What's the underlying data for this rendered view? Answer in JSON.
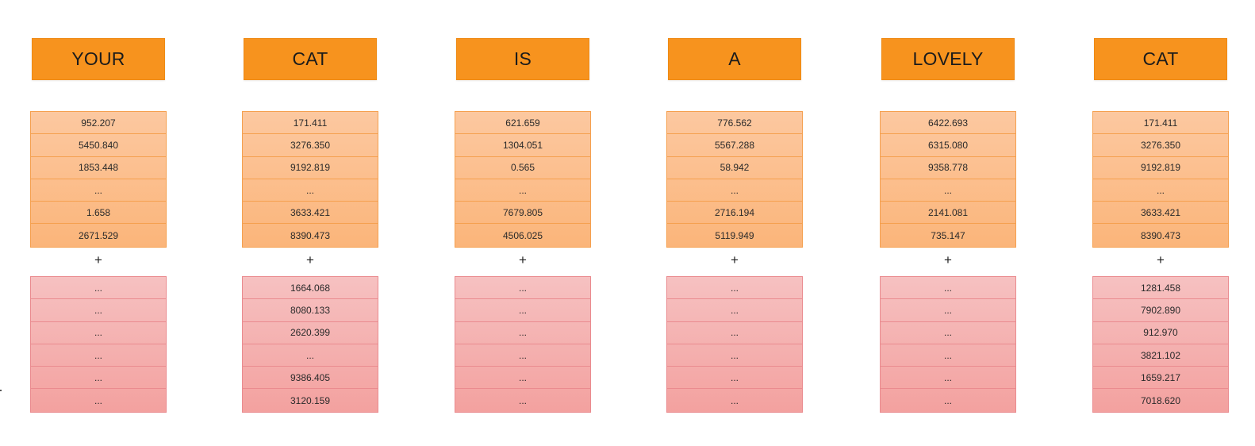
{
  "columns": [
    {
      "word": "YOUR",
      "embedding": [
        "952.207",
        "5450.840",
        "1853.448",
        "...",
        "1.658",
        "2671.529"
      ],
      "plus": "+",
      "position": [
        "...",
        "...",
        "...",
        "...",
        "...",
        "..."
      ]
    },
    {
      "word": "CAT",
      "embedding": [
        "171.411",
        "3276.350",
        "9192.819",
        "...",
        "3633.421",
        "8390.473"
      ],
      "plus": "+",
      "position": [
        "1664.068",
        "8080.133",
        "2620.399",
        "...",
        "9386.405",
        "3120.159"
      ]
    },
    {
      "word": "IS",
      "embedding": [
        "621.659",
        "1304.051",
        "0.565",
        "...",
        "7679.805",
        "4506.025"
      ],
      "plus": "+",
      "position": [
        "...",
        "...",
        "...",
        "...",
        "...",
        "..."
      ]
    },
    {
      "word": "A",
      "embedding": [
        "776.562",
        "5567.288",
        "58.942",
        "...",
        "2716.194",
        "5119.949"
      ],
      "plus": "+",
      "position": [
        "...",
        "...",
        "...",
        "...",
        "...",
        "..."
      ]
    },
    {
      "word": "LOVELY",
      "embedding": [
        "6422.693",
        "6315.080",
        "9358.778",
        "...",
        "2141.081",
        "735.147"
      ],
      "plus": "+",
      "position": [
        "...",
        "...",
        "...",
        "...",
        "...",
        "..."
      ]
    },
    {
      "word": "CAT",
      "embedding": [
        "171.411",
        "3276.350",
        "9192.819",
        "...",
        "3633.421",
        "8390.473"
      ],
      "plus": "+",
      "position": [
        "1281.458",
        "7902.890",
        "912.970",
        "3821.102",
        "1659.217",
        "7018.620"
      ]
    }
  ],
  "colors": {
    "word_box": "#f7931e",
    "embedding_fill": "#fbb57a",
    "embedding_border": "#f5a04f",
    "position_fill": "#f3a19f",
    "position_border": "#ea8b8f"
  }
}
